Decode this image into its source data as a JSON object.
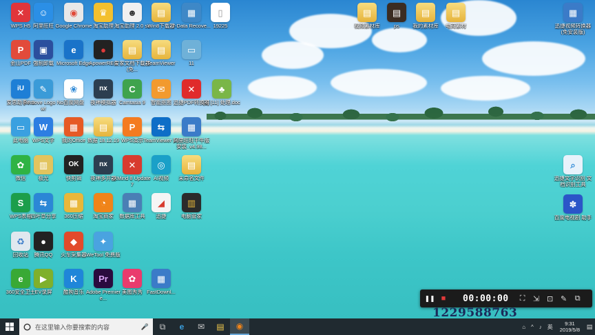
{
  "desktop": {
    "icons": [
      {
        "label": "WPS H5",
        "glyph": "✕",
        "color": "#e0353b"
      },
      {
        "label": "阿里旺旺",
        "glyph": "☺",
        "color": "#2b8fe6"
      },
      {
        "label": "Google Chrome",
        "glyph": "◉",
        "color": "#e8e8e8"
      },
      {
        "label": "淘宝助理",
        "glyph": "♛",
        "color": "#f3c02e"
      },
      {
        "label": "淘宝助理 2.0 se",
        "glyph": "☻",
        "color": "#f0f0f0"
      },
      {
        "label": "Win8下载器",
        "glyph": "▤",
        "color": "#e8c55a"
      },
      {
        "label": "7-Data Recove...",
        "glyph": "▦",
        "color": "#3e88c7"
      },
      {
        "label": "19225",
        "glyph": "▯",
        "color": "#ffffff"
      },
      {
        "label": "金山PDF",
        "glyph": "P",
        "color": "#e24b3b"
      },
      {
        "label": "强制卸载",
        "glyph": "▣",
        "color": "#2b4f9e"
      },
      {
        "label": "Microsoft Edge",
        "glyph": "e",
        "color": "#1a73c9"
      },
      {
        "label": "ApowerREC",
        "glyph": "●",
        "color": "#222222"
      },
      {
        "label": "爱家文档下载器(免...",
        "glyph": "▤",
        "color": "#f2d27c"
      },
      {
        "label": "TeamViewer",
        "glyph": "▤",
        "color": "#f2d27c"
      },
      {
        "label": "11",
        "glyph": "▭",
        "color": "#6fb1d8"
      },
      {
        "label": "爱思助手7.0",
        "glyph": "iU",
        "color": "#1e7fd6"
      },
      {
        "label": "Remove Logo Now!",
        "glyph": "✎",
        "color": "#3a9bd8"
      },
      {
        "label": "百度网盘",
        "glyph": "❀",
        "color": "#ffffff"
      },
      {
        "label": "夜神模拟器",
        "glyph": "nx",
        "color": "#2c3e50"
      },
      {
        "label": "Camtasia 9",
        "glyph": "C",
        "color": "#3fa34d"
      },
      {
        "label": "智能抠图",
        "glyph": "✉",
        "color": "#f29a2e"
      },
      {
        "label": "迅捷PDF转换器",
        "glyph": "✕",
        "color": "#e02b2b"
      },
      {
        "label": "[4] [11] 处理.doc",
        "glyph": "♣",
        "color": "#7ab648"
      },
      {
        "label": "此电脑",
        "glyph": "▭",
        "color": "#3aa0e0"
      },
      {
        "label": "WPS文字",
        "glyph": "W",
        "color": "#2d7ee2"
      },
      {
        "label": "我的Office",
        "glyph": "▦",
        "color": "#e65a25"
      },
      {
        "label": "数据 18.12.19",
        "glyph": "▤",
        "color": "#f2d27c"
      },
      {
        "label": "WPS演示",
        "glyph": "P",
        "color": "#f47b20"
      },
      {
        "label": "TeamViewer 13",
        "glyph": "⇆",
        "color": "#0e6ec7"
      },
      {
        "label": "阿里旺旺千牛版 安装_v4.98...",
        "glyph": "▦",
        "color": "#3b7bc8"
      },
      {
        "label": "微信",
        "glyph": "✿",
        "color": "#2fb344"
      },
      {
        "label": "极光",
        "glyph": "▥",
        "color": "#e2c45e"
      },
      {
        "label": "快剪辑",
        "glyph": "OK",
        "color": "#222222"
      },
      {
        "label": "夜神多开器",
        "glyph": "nx",
        "color": "#2c3e50"
      },
      {
        "label": "XMind 8 Update 7",
        "glyph": "✕",
        "color": "#d83b2f"
      },
      {
        "label": "AI视频",
        "glyph": "◎",
        "color": "#1aa0c8"
      },
      {
        "label": "未命名文件",
        "glyph": "▤",
        "color": "#f2d27c"
      },
      {
        "label": "WPS表格",
        "glyph": "S",
        "color": "#1c9e4b"
      },
      {
        "label": "四叶草分享",
        "glyph": "⇆",
        "color": "#2b87d6"
      },
      {
        "label": "360压缩",
        "glyph": "▦",
        "color": "#e9b73a"
      },
      {
        "label": "淘宝商家",
        "glyph": "◔",
        "color": "#f08419"
      },
      {
        "label": "数据库工具",
        "glyph": "▦",
        "color": "#4a7fb5"
      },
      {
        "label": "迅捷",
        "glyph": "◢",
        "color": "#f5f5f5"
      },
      {
        "label": "电脑管家",
        "glyph": "▥",
        "color": "#2b2b2b"
      },
      {
        "label": "回收站",
        "glyph": "♻",
        "color": "#e0e8ef"
      },
      {
        "label": "腾讯QQ",
        "glyph": "●",
        "color": "#222222"
      },
      {
        "label": "火车采集器",
        "glyph": "◆",
        "color": "#e24a2b"
      },
      {
        "label": "WeTool 免费版",
        "glyph": "✦",
        "color": "#4aa3e0"
      },
      {
        "label": "360安全卫士",
        "glyph": "e",
        "color": "#39a935"
      },
      {
        "label": "EV录屏",
        "glyph": "▶",
        "color": "#7fb02c"
      },
      {
        "label": "酷狗音乐",
        "glyph": "K",
        "color": "#1f86d9"
      },
      {
        "label": "Adobe Premiere...",
        "glyph": "Pr",
        "color": "#2a0b3e"
      },
      {
        "label": "美图秀秀",
        "glyph": "✿",
        "color": "#ea3b6d"
      },
      {
        "label": "FastDownl...",
        "glyph": "▦",
        "color": "#3b7bc8"
      },
      {
        "label": "视频素材库",
        "glyph": "▤",
        "color": "#f2d27c"
      },
      {
        "label": "ps",
        "glyph": "▤",
        "color": "#3b2c22"
      },
      {
        "label": "我的素材库",
        "glyph": "▤",
        "color": "#f2d27c"
      },
      {
        "label": "电商素材",
        "glyph": "▤",
        "color": "#f2d27c"
      },
      {
        "label": "迅捷视频转换器(免安装版)",
        "glyph": "▦",
        "color": "#3b7bc8"
      },
      {
        "label": "迅捷文字识别 文档识别工具",
        "glyph": "⌕",
        "color": "#e8f2fb"
      },
      {
        "label": "百度电视剧 助手",
        "glyph": "✽",
        "color": "#2b55c8"
      }
    ]
  },
  "recorder": {
    "time": "00:00:00",
    "pause_glyph": "❚❚",
    "stop_glyph": "■",
    "tools": [
      "⛶",
      "⇲",
      "⊡",
      "✎",
      "⧉"
    ]
  },
  "watermark": "1229588763",
  "taskbar": {
    "start_icon": "windows-logo",
    "search_placeholder": "在这里输入你要搜索的内容",
    "mic_glyph": "🎤",
    "apps": [
      "⧉",
      "e",
      "✉",
      "▤",
      "◉"
    ],
    "tray": [
      "⌂",
      "^",
      "♪",
      "英"
    ],
    "time": "9:31",
    "date": "2019/5/8",
    "notif_glyph": "▤"
  },
  "colors": {
    "taskbar": "#202a30",
    "recorder": "#1b1b1b",
    "stop": "#e03a3a"
  }
}
